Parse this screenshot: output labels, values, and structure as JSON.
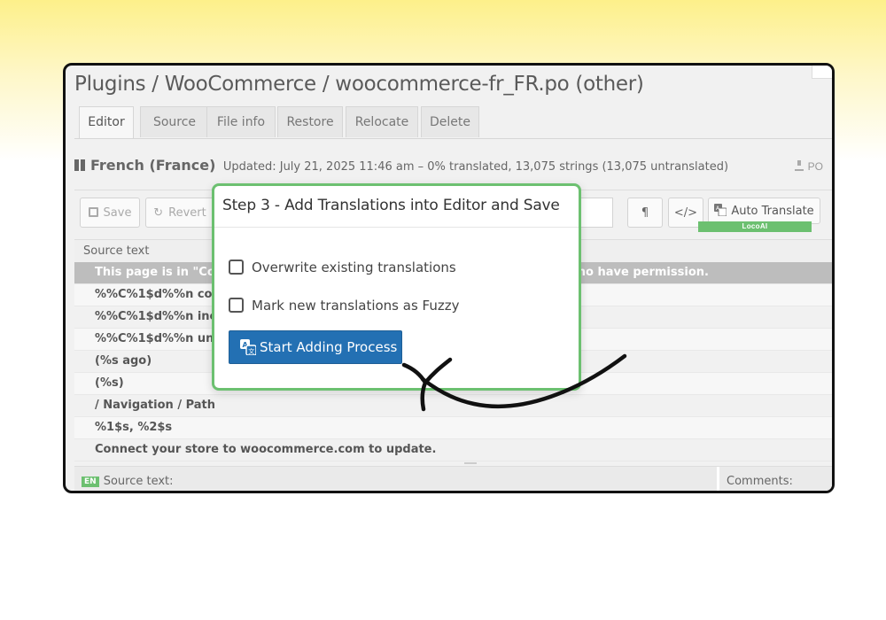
{
  "breadcrumb": "Plugins / WooCommerce / woocommerce-fr_FR.po (other)",
  "tabs": [
    {
      "label": "Editor",
      "active": true
    },
    {
      "label": "Source"
    },
    {
      "label": "File info"
    },
    {
      "label": "Restore"
    },
    {
      "label": "Relocate"
    },
    {
      "label": "Delete"
    }
  ],
  "language": {
    "name": "French (France)",
    "meta": "Updated: July 21, 2025 11:46 am – 0% translated, 13,075 strings (13,075 untranslated)",
    "download_label": "PO"
  },
  "toolbar": {
    "save_label": "Save",
    "revert_label": "Revert",
    "pilcrow": "¶",
    "code": "</>",
    "auto_translate_label": "Auto Translate",
    "locoai_badge": "LocoAI"
  },
  "table": {
    "header": "Source text",
    "rows": [
      "This page is in \"Coming soon\" mode and is only visible to you and those who have permission.",
      "%%C%1$d%%n comments",
      "%%C%1$d%%n incomplete",
      "%%C%1$d%%n unclaimed",
      "(%s ago)",
      "(%s)",
      "/ Navigation / Path",
      "%1$s, %2$s",
      "Connect your store to woocommerce.com to update."
    ]
  },
  "bottom": {
    "en_badge": "EN",
    "source_label": "Source text:",
    "comments_label": "Comments:"
  },
  "dialog": {
    "title": "Step 3 - Add Translations into Editor and Save",
    "overwrite_label": "Overwrite existing translations",
    "fuzzy_label": "Mark new translations as Fuzzy",
    "start_button": "Start Adding Process"
  },
  "colors": {
    "accent_green": "#6cc070",
    "primary_blue": "#2370b3"
  }
}
